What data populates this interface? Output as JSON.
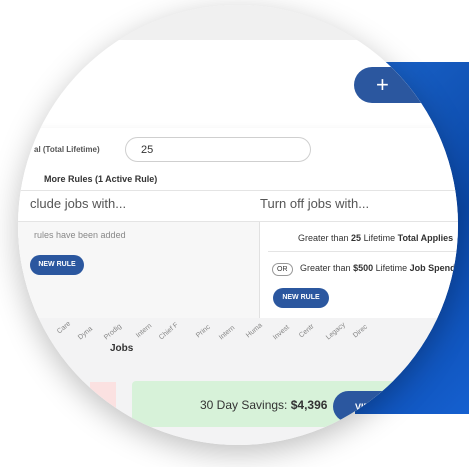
{
  "header": {
    "add_button_label": "+"
  },
  "rule": {
    "field_label": "al (Total Lifetime)",
    "field_value": "25",
    "more_rules_label": "More Rules (1 Active Rule)",
    "more_rules_caret": "▼"
  },
  "columns": {
    "include_header": "clude jobs with...",
    "turn_off_header": "Turn off jobs with...",
    "include_empty_text": "rules have been added",
    "new_rule_label": "NEW RULE"
  },
  "turn_off_rules": [
    {
      "connector": "",
      "prefix": "Greater than",
      "value": "25",
      "scope": "Lifetime",
      "metric": "Total Applies"
    },
    {
      "connector": "OR",
      "prefix": "Greater than",
      "value": "$500",
      "scope": "Lifetime",
      "metric": "Job Spend"
    }
  ],
  "chart": {
    "axis_title": "Jobs",
    "tick_labels": [
      "Care",
      "Dyna",
      "Prodig",
      "Intern",
      "Chief F",
      "Princ",
      "Intern",
      "Huma",
      "Invest",
      "Centr",
      "Legacy",
      "Direc"
    ]
  },
  "savings": {
    "label": "30 Day Savings:",
    "amount": "$4,396",
    "view_label": "VIEW"
  }
}
